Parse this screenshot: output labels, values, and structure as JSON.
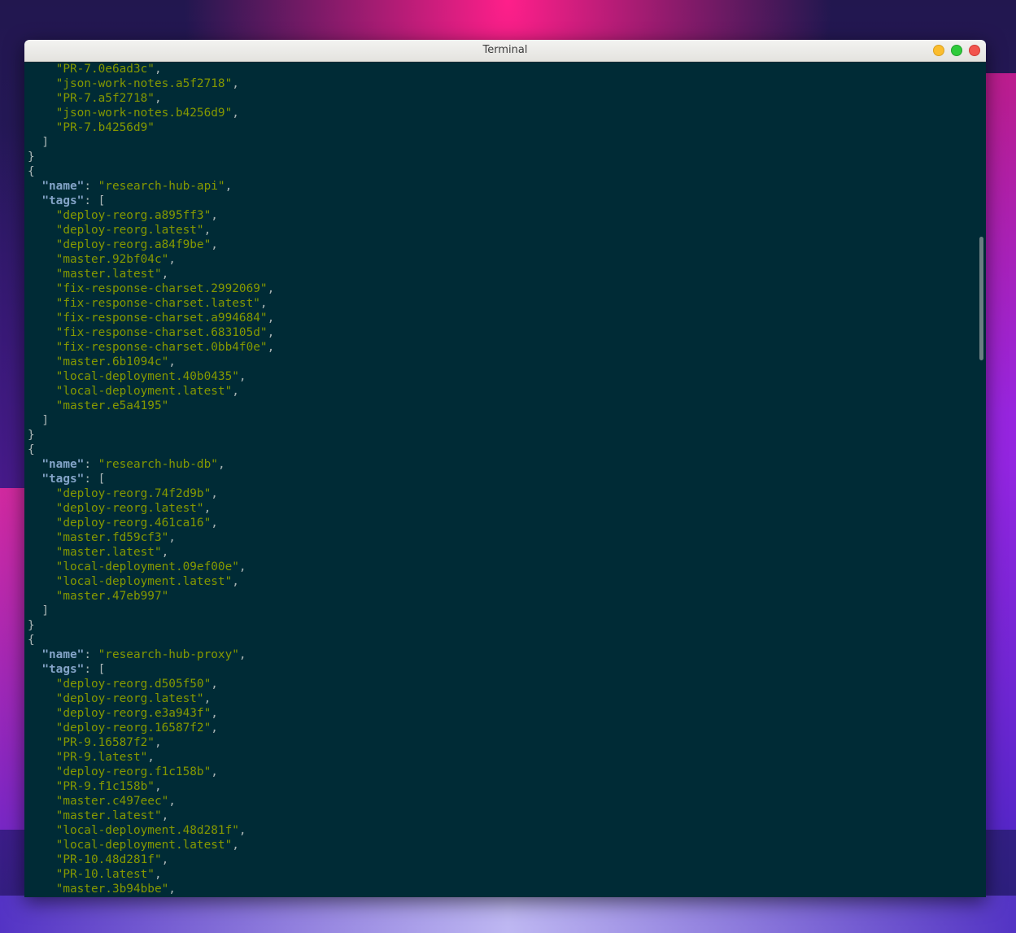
{
  "window": {
    "title": "Terminal",
    "minimize_icon": "minimize-circle-icon",
    "maximize_icon": "maximize-circle-icon",
    "close_icon": "close-circle-icon"
  },
  "colors": {
    "terminal_bg": "#002b36",
    "string": "#859900",
    "key": "#84a4c8",
    "punctuation": "#aab6b6"
  },
  "terminal": {
    "lines": [
      [
        {
          "t": "    "
        },
        {
          "t": "\"PR-7.0e6ad3c\"",
          "c": "str"
        },
        {
          "t": ",",
          "c": "punc"
        }
      ],
      [
        {
          "t": "    "
        },
        {
          "t": "\"json-work-notes.a5f2718\"",
          "c": "str"
        },
        {
          "t": ",",
          "c": "punc"
        }
      ],
      [
        {
          "t": "    "
        },
        {
          "t": "\"PR-7.a5f2718\"",
          "c": "str"
        },
        {
          "t": ",",
          "c": "punc"
        }
      ],
      [
        {
          "t": "    "
        },
        {
          "t": "\"json-work-notes.b4256d9\"",
          "c": "str"
        },
        {
          "t": ",",
          "c": "punc"
        }
      ],
      [
        {
          "t": "    "
        },
        {
          "t": "\"PR-7.b4256d9\"",
          "c": "str"
        }
      ],
      [
        {
          "t": "  "
        },
        {
          "t": "]",
          "c": "punc"
        }
      ],
      [
        {
          "t": "}",
          "c": "punc"
        }
      ],
      [
        {
          "t": "{",
          "c": "punc"
        }
      ],
      [
        {
          "t": "  "
        },
        {
          "t": "\"name\"",
          "c": "key"
        },
        {
          "t": ": ",
          "c": "punc"
        },
        {
          "t": "\"research-hub-api\"",
          "c": "str"
        },
        {
          "t": ",",
          "c": "punc"
        }
      ],
      [
        {
          "t": "  "
        },
        {
          "t": "\"tags\"",
          "c": "key"
        },
        {
          "t": ": [",
          "c": "punc"
        }
      ],
      [
        {
          "t": "    "
        },
        {
          "t": "\"deploy-reorg.a895ff3\"",
          "c": "str"
        },
        {
          "t": ",",
          "c": "punc"
        }
      ],
      [
        {
          "t": "    "
        },
        {
          "t": "\"deploy-reorg.latest\"",
          "c": "str"
        },
        {
          "t": ",",
          "c": "punc"
        }
      ],
      [
        {
          "t": "    "
        },
        {
          "t": "\"deploy-reorg.a84f9be\"",
          "c": "str"
        },
        {
          "t": ",",
          "c": "punc"
        }
      ],
      [
        {
          "t": "    "
        },
        {
          "t": "\"master.92bf04c\"",
          "c": "str"
        },
        {
          "t": ",",
          "c": "punc"
        }
      ],
      [
        {
          "t": "    "
        },
        {
          "t": "\"master.latest\"",
          "c": "str"
        },
        {
          "t": ",",
          "c": "punc"
        }
      ],
      [
        {
          "t": "    "
        },
        {
          "t": "\"fix-response-charset.2992069\"",
          "c": "str"
        },
        {
          "t": ",",
          "c": "punc"
        }
      ],
      [
        {
          "t": "    "
        },
        {
          "t": "\"fix-response-charset.latest\"",
          "c": "str"
        },
        {
          "t": ",",
          "c": "punc"
        }
      ],
      [
        {
          "t": "    "
        },
        {
          "t": "\"fix-response-charset.a994684\"",
          "c": "str"
        },
        {
          "t": ",",
          "c": "punc"
        }
      ],
      [
        {
          "t": "    "
        },
        {
          "t": "\"fix-response-charset.683105d\"",
          "c": "str"
        },
        {
          "t": ",",
          "c": "punc"
        }
      ],
      [
        {
          "t": "    "
        },
        {
          "t": "\"fix-response-charset.0bb4f0e\"",
          "c": "str"
        },
        {
          "t": ",",
          "c": "punc"
        }
      ],
      [
        {
          "t": "    "
        },
        {
          "t": "\"master.6b1094c\"",
          "c": "str"
        },
        {
          "t": ",",
          "c": "punc"
        }
      ],
      [
        {
          "t": "    "
        },
        {
          "t": "\"local-deployment.40b0435\"",
          "c": "str"
        },
        {
          "t": ",",
          "c": "punc"
        }
      ],
      [
        {
          "t": "    "
        },
        {
          "t": "\"local-deployment.latest\"",
          "c": "str"
        },
        {
          "t": ",",
          "c": "punc"
        }
      ],
      [
        {
          "t": "    "
        },
        {
          "t": "\"master.e5a4195\"",
          "c": "str"
        }
      ],
      [
        {
          "t": "  "
        },
        {
          "t": "]",
          "c": "punc"
        }
      ],
      [
        {
          "t": "}",
          "c": "punc"
        }
      ],
      [
        {
          "t": "{",
          "c": "punc"
        }
      ],
      [
        {
          "t": "  "
        },
        {
          "t": "\"name\"",
          "c": "key"
        },
        {
          "t": ": ",
          "c": "punc"
        },
        {
          "t": "\"research-hub-db\"",
          "c": "str"
        },
        {
          "t": ",",
          "c": "punc"
        }
      ],
      [
        {
          "t": "  "
        },
        {
          "t": "\"tags\"",
          "c": "key"
        },
        {
          "t": ": [",
          "c": "punc"
        }
      ],
      [
        {
          "t": "    "
        },
        {
          "t": "\"deploy-reorg.74f2d9b\"",
          "c": "str"
        },
        {
          "t": ",",
          "c": "punc"
        }
      ],
      [
        {
          "t": "    "
        },
        {
          "t": "\"deploy-reorg.latest\"",
          "c": "str"
        },
        {
          "t": ",",
          "c": "punc"
        }
      ],
      [
        {
          "t": "    "
        },
        {
          "t": "\"deploy-reorg.461ca16\"",
          "c": "str"
        },
        {
          "t": ",",
          "c": "punc"
        }
      ],
      [
        {
          "t": "    "
        },
        {
          "t": "\"master.fd59cf3\"",
          "c": "str"
        },
        {
          "t": ",",
          "c": "punc"
        }
      ],
      [
        {
          "t": "    "
        },
        {
          "t": "\"master.latest\"",
          "c": "str"
        },
        {
          "t": ",",
          "c": "punc"
        }
      ],
      [
        {
          "t": "    "
        },
        {
          "t": "\"local-deployment.09ef00e\"",
          "c": "str"
        },
        {
          "t": ",",
          "c": "punc"
        }
      ],
      [
        {
          "t": "    "
        },
        {
          "t": "\"local-deployment.latest\"",
          "c": "str"
        },
        {
          "t": ",",
          "c": "punc"
        }
      ],
      [
        {
          "t": "    "
        },
        {
          "t": "\"master.47eb997\"",
          "c": "str"
        }
      ],
      [
        {
          "t": "  "
        },
        {
          "t": "]",
          "c": "punc"
        }
      ],
      [
        {
          "t": "}",
          "c": "punc"
        }
      ],
      [
        {
          "t": "{",
          "c": "punc"
        }
      ],
      [
        {
          "t": "  "
        },
        {
          "t": "\"name\"",
          "c": "key"
        },
        {
          "t": ": ",
          "c": "punc"
        },
        {
          "t": "\"research-hub-proxy\"",
          "c": "str"
        },
        {
          "t": ",",
          "c": "punc"
        }
      ],
      [
        {
          "t": "  "
        },
        {
          "t": "\"tags\"",
          "c": "key"
        },
        {
          "t": ": [",
          "c": "punc"
        }
      ],
      [
        {
          "t": "    "
        },
        {
          "t": "\"deploy-reorg.d505f50\"",
          "c": "str"
        },
        {
          "t": ",",
          "c": "punc"
        }
      ],
      [
        {
          "t": "    "
        },
        {
          "t": "\"deploy-reorg.latest\"",
          "c": "str"
        },
        {
          "t": ",",
          "c": "punc"
        }
      ],
      [
        {
          "t": "    "
        },
        {
          "t": "\"deploy-reorg.e3a943f\"",
          "c": "str"
        },
        {
          "t": ",",
          "c": "punc"
        }
      ],
      [
        {
          "t": "    "
        },
        {
          "t": "\"deploy-reorg.16587f2\"",
          "c": "str"
        },
        {
          "t": ",",
          "c": "punc"
        }
      ],
      [
        {
          "t": "    "
        },
        {
          "t": "\"PR-9.16587f2\"",
          "c": "str"
        },
        {
          "t": ",",
          "c": "punc"
        }
      ],
      [
        {
          "t": "    "
        },
        {
          "t": "\"PR-9.latest\"",
          "c": "str"
        },
        {
          "t": ",",
          "c": "punc"
        }
      ],
      [
        {
          "t": "    "
        },
        {
          "t": "\"deploy-reorg.f1c158b\"",
          "c": "str"
        },
        {
          "t": ",",
          "c": "punc"
        }
      ],
      [
        {
          "t": "    "
        },
        {
          "t": "\"PR-9.f1c158b\"",
          "c": "str"
        },
        {
          "t": ",",
          "c": "punc"
        }
      ],
      [
        {
          "t": "    "
        },
        {
          "t": "\"master.c497eec\"",
          "c": "str"
        },
        {
          "t": ",",
          "c": "punc"
        }
      ],
      [
        {
          "t": "    "
        },
        {
          "t": "\"master.latest\"",
          "c": "str"
        },
        {
          "t": ",",
          "c": "punc"
        }
      ],
      [
        {
          "t": "    "
        },
        {
          "t": "\"local-deployment.48d281f\"",
          "c": "str"
        },
        {
          "t": ",",
          "c": "punc"
        }
      ],
      [
        {
          "t": "    "
        },
        {
          "t": "\"local-deployment.latest\"",
          "c": "str"
        },
        {
          "t": ",",
          "c": "punc"
        }
      ],
      [
        {
          "t": "    "
        },
        {
          "t": "\"PR-10.48d281f\"",
          "c": "str"
        },
        {
          "t": ",",
          "c": "punc"
        }
      ],
      [
        {
          "t": "    "
        },
        {
          "t": "\"PR-10.latest\"",
          "c": "str"
        },
        {
          "t": ",",
          "c": "punc"
        }
      ],
      [
        {
          "t": "    "
        },
        {
          "t": "\"master.3b94bbe\"",
          "c": "str"
        },
        {
          "t": ",",
          "c": "punc"
        }
      ]
    ]
  }
}
